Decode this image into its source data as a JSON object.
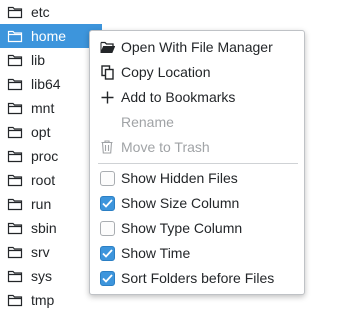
{
  "file_list": {
    "items": [
      {
        "name": "etc",
        "icon": "folder-icon",
        "selected": false
      },
      {
        "name": "home",
        "icon": "folder-icon",
        "selected": true
      },
      {
        "name": "lib",
        "icon": "folder-icon",
        "selected": false
      },
      {
        "name": "lib64",
        "icon": "folder-icon",
        "selected": false
      },
      {
        "name": "mnt",
        "icon": "folder-icon",
        "selected": false
      },
      {
        "name": "opt",
        "icon": "folder-icon",
        "selected": false
      },
      {
        "name": "proc",
        "icon": "folder-icon",
        "selected": false
      },
      {
        "name": "root",
        "icon": "folder-icon",
        "selected": false
      },
      {
        "name": "run",
        "icon": "folder-icon",
        "selected": false
      },
      {
        "name": "sbin",
        "icon": "folder-icon",
        "selected": false
      },
      {
        "name": "srv",
        "icon": "folder-icon",
        "selected": false
      },
      {
        "name": "sys",
        "icon": "folder-icon",
        "selected": false
      },
      {
        "name": "tmp",
        "icon": "folder-icon",
        "selected": false
      }
    ]
  },
  "context_menu": {
    "actions": [
      {
        "label": "Open With File Manager",
        "icon": "folder-open-icon",
        "enabled": true
      },
      {
        "label": "Copy Location",
        "icon": "copy-icon",
        "enabled": true
      },
      {
        "label": "Add to Bookmarks",
        "icon": "plus-icon",
        "enabled": true
      },
      {
        "label": "Rename",
        "icon": "",
        "enabled": false
      },
      {
        "label": "Move to Trash",
        "icon": "trash-icon",
        "enabled": false
      }
    ],
    "options": [
      {
        "label": "Show Hidden Files",
        "checked": false
      },
      {
        "label": "Show Size Column",
        "checked": true
      },
      {
        "label": "Show Type Column",
        "checked": false
      },
      {
        "label": "Show Time",
        "checked": true
      },
      {
        "label": "Sort Folders before Files",
        "checked": true
      }
    ]
  },
  "colors": {
    "selection": "#3d95dc",
    "text": "#232629",
    "disabled_text": "#a0a3a6",
    "menu_border": "#bfc2c6"
  }
}
